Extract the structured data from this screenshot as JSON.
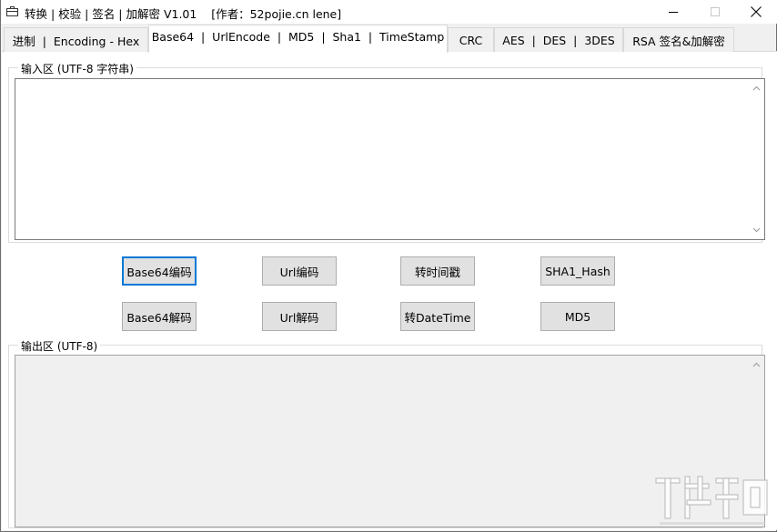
{
  "window": {
    "title": "转换 | 校验 | 签名 | 加解密 V1.01    [作者：52pojie.cn lene]"
  },
  "tabs": [
    {
      "label": "进制  |  Encoding - Hex",
      "active": false
    },
    {
      "label": "Base64  |  UrlEncode  |  MD5  |  Sha1  |  TimeStamp",
      "active": true
    },
    {
      "label": "CRC",
      "active": false
    },
    {
      "label": "AES  |  DES  |  3DES",
      "active": false
    },
    {
      "label": "RSA 签名&加解密",
      "active": false
    }
  ],
  "input_group": {
    "legend": "输入区 (UTF-8 字符串)",
    "value": ""
  },
  "buttons": {
    "base64_encode": "Base64编码",
    "url_encode": "Url编码",
    "to_timestamp": "转时间戳",
    "sha1_hash": "SHA1_Hash",
    "base64_decode": "Base64解码",
    "url_decode": "Url解码",
    "to_datetime": "转DateTime",
    "md5": "MD5"
  },
  "output_group": {
    "legend": "输出区 (UTF-8)",
    "value": ""
  },
  "icons": {
    "app": "briefcase-icon",
    "minimize": "minimize-icon",
    "maximize": "maximize-icon",
    "close": "close-icon",
    "scroll_up": "chevron-up-icon",
    "scroll_down": "chevron-down-icon"
  },
  "colors": {
    "focus_accent": "#0078d7",
    "button_face": "#e1e1e1",
    "pane_bg": "#ffffff",
    "window_bg": "#f0f0f0"
  }
}
